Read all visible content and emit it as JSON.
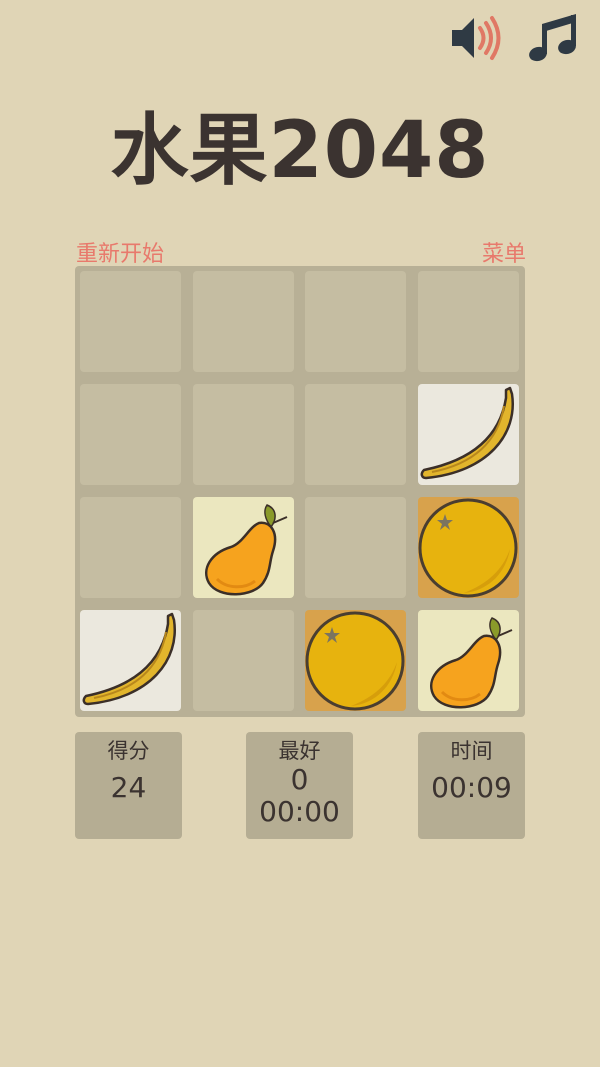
{
  "title": "水果2048",
  "top_icons": [
    "speaker-icon",
    "music-note-icon"
  ],
  "controls": {
    "restart_label": "重新开始",
    "menu_label": "菜单"
  },
  "colors": {
    "background": "#e0d5b6",
    "title": "#3b3330",
    "link": "#e8796c",
    "board": "#b8b096",
    "empty_cell": "#c5bda2"
  },
  "board": {
    "rows": [
      [
        "",
        "",
        "",
        ""
      ],
      [
        "",
        "",
        "",
        "banana"
      ],
      [
        "",
        "pear",
        "",
        "orange"
      ],
      [
        "banana",
        "",
        "orange",
        "pear"
      ]
    ]
  },
  "stats": {
    "score": {
      "label": "得分",
      "value": "24"
    },
    "best": {
      "label": "最好",
      "value": "0",
      "time": "00:00"
    },
    "time": {
      "label": "时间",
      "value": "00:09"
    }
  }
}
